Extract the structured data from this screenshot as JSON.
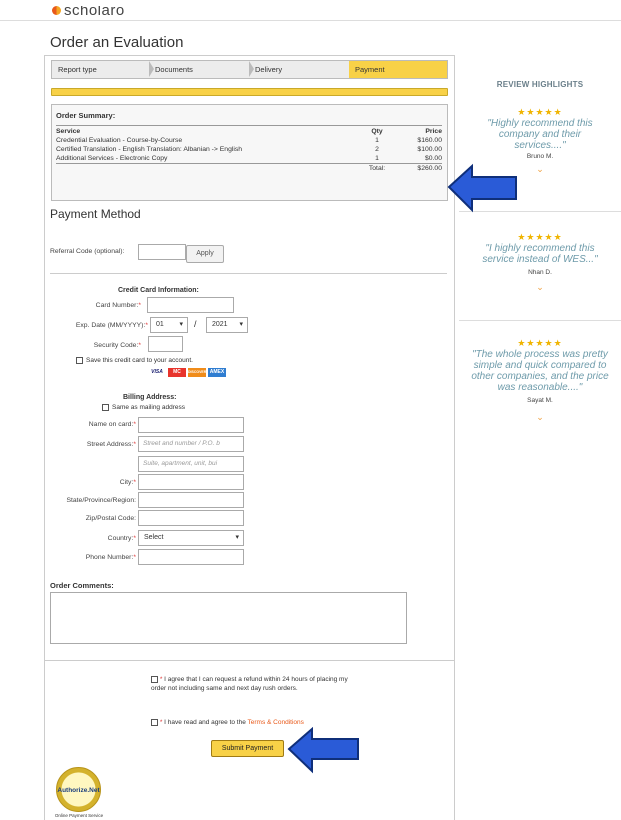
{
  "brand": {
    "name": "scholaro"
  },
  "page_title": "Order an Evaluation",
  "steps": [
    "Report type",
    "Documents",
    "Delivery",
    "Payment"
  ],
  "order_summary": {
    "title": "Order Summary:",
    "headers": {
      "service": "Service",
      "qty": "Qty",
      "price": "Price"
    },
    "rows": [
      {
        "service": "Credential Evaluation - Course-by-Course",
        "qty": "1",
        "price": "$160.00"
      },
      {
        "service": "Certified Translation - English Translation: Albanian -> English",
        "qty": "2",
        "price": "$100.00"
      },
      {
        "service": "Additional Services - Electronic Copy",
        "qty": "1",
        "price": "$0.00"
      }
    ],
    "total_label": "Total:",
    "total_value": "$260.00"
  },
  "payment": {
    "heading": "Payment Method",
    "referral_label": "Referral Code (optional):",
    "apply_label": "Apply",
    "cc_heading": "Credit Card Information:",
    "card_number_label": "Card Number:",
    "exp_label": "Exp. Date (MM/YYYY):",
    "exp_month": "01",
    "exp_year": "2021",
    "exp_sep": "/",
    "security_label": "Security Code:",
    "save_card_label": "Save this credit card to your account.",
    "card_brands": [
      "VISA",
      "MC",
      "DISCOVER",
      "AMEX"
    ],
    "billing_heading": "Billing Address:",
    "same_as_mailing": "Same as mailing address",
    "name_label": "Name on card:",
    "street_label": "Street Address:",
    "street_placeholder": "Street and number / P.O. b",
    "street2_placeholder": "Suite, apartment, unit, bui",
    "city_label": "City:",
    "state_label": "State/Province/Region:",
    "zip_label": "Zip/Postal Code:",
    "country_label": "Country:",
    "country_value": "Select",
    "phone_label": "Phone Number:",
    "required_mark": "*",
    "comments_label": "Order Comments:",
    "refund_text": "I agree that I can request a refund within 24 hours of placing my order not including same and next day rush orders.",
    "terms_prefix": "I have read and agree to the ",
    "terms_link": "Terms & Conditions",
    "submit_label": "Submit Payment",
    "badge_label": "Authorize.Net",
    "badge_caption": "Online Payment Service"
  },
  "sidebar": {
    "title": "REVIEW HIGHLIGHTS",
    "stars": "★★★★★",
    "chevron": "⌄",
    "reviews": [
      {
        "quote": "\"Highly recommend this company and their services....\"",
        "name": "Bruno M."
      },
      {
        "quote": "\"I highly recommend this service instead of WES...\"",
        "name": "Nhan D."
      },
      {
        "quote": "\"The whole process was pretty simple and quick compared to other companies, and the price was reasonable....\"",
        "name": "Sayat M."
      }
    ]
  },
  "colors": {
    "accent": "#f8d147",
    "link": "#e8591a",
    "quote": "#6e9baa",
    "arrow": "#2a5bd7"
  }
}
